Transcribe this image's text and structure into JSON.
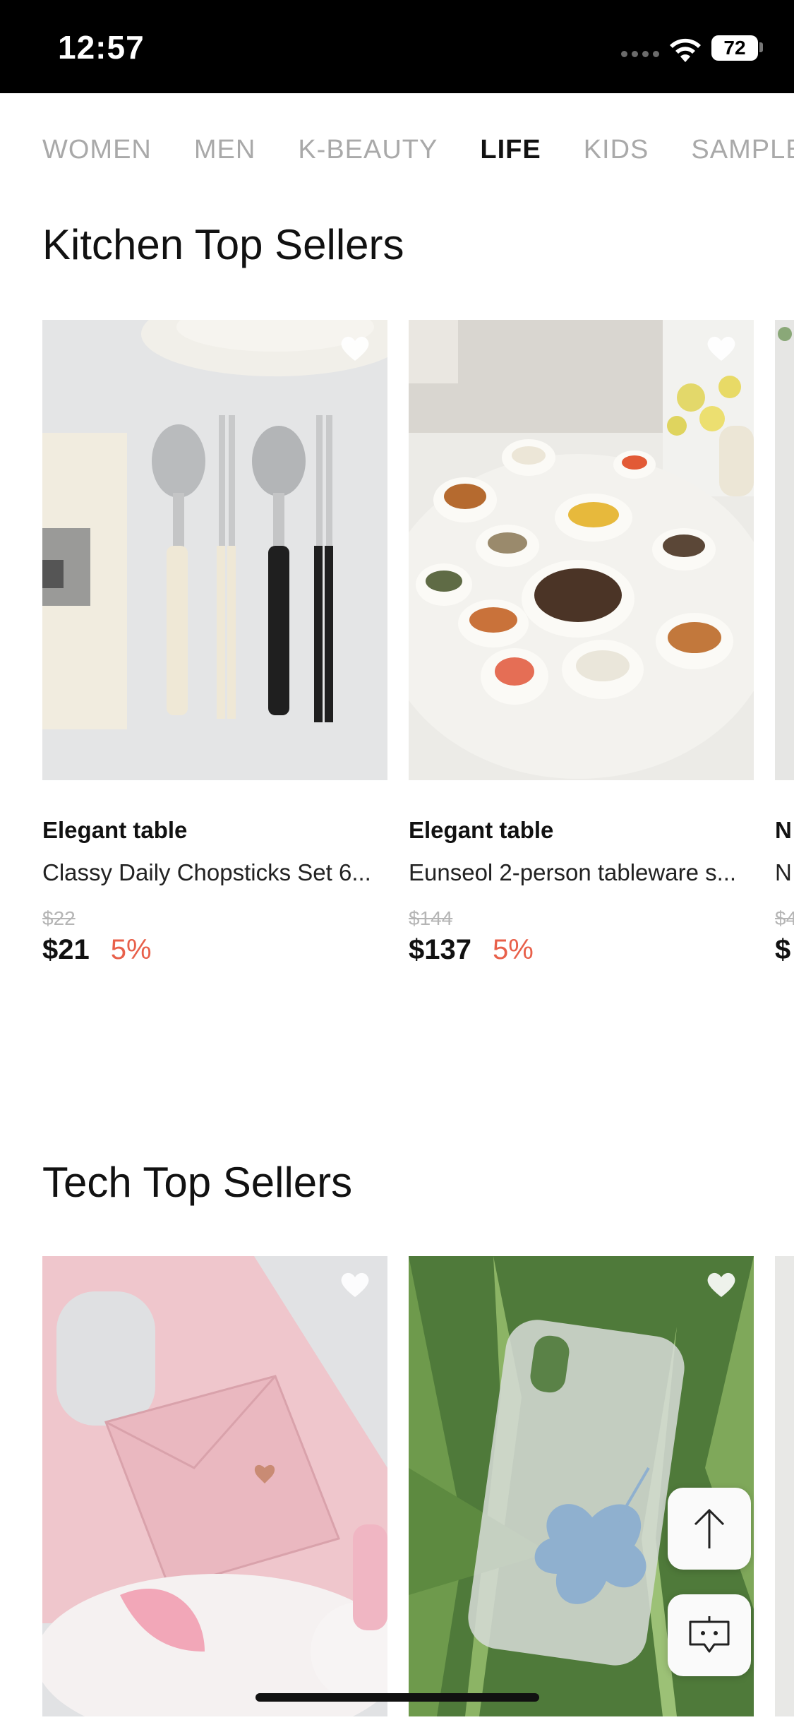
{
  "status_bar": {
    "time": "12:57",
    "battery": "72"
  },
  "nav": {
    "tabs": [
      {
        "label": "WOMEN",
        "active": false
      },
      {
        "label": "MEN",
        "active": false
      },
      {
        "label": "K-BEAUTY",
        "active": false
      },
      {
        "label": "LIFE",
        "active": true
      },
      {
        "label": "KIDS",
        "active": false
      },
      {
        "label": "SAMPLE",
        "active": false
      }
    ]
  },
  "sections": [
    {
      "title": "Kitchen Top Sellers",
      "products": [
        {
          "brand": "Elegant table",
          "name": "Classy Daily Chopsticks Set 6...",
          "old_price": "$22",
          "price": "$21",
          "discount": "5%"
        },
        {
          "brand": "Elegant table",
          "name": "Eunseol 2-person tableware s...",
          "old_price": "$144",
          "price": "$137",
          "discount": "5%"
        },
        {
          "brand": "N",
          "name": "N",
          "old_price": "$4",
          "price": "$",
          "discount": ""
        }
      ]
    },
    {
      "title": "Tech Top Sellers",
      "products": []
    }
  ],
  "floating": {
    "scroll_top_icon": "arrow-up-icon",
    "chat_icon": "chat-icon"
  },
  "colors": {
    "discount": "#e8604a",
    "active_tab": "#111111",
    "inactive_tab": "#a9a9a9"
  }
}
